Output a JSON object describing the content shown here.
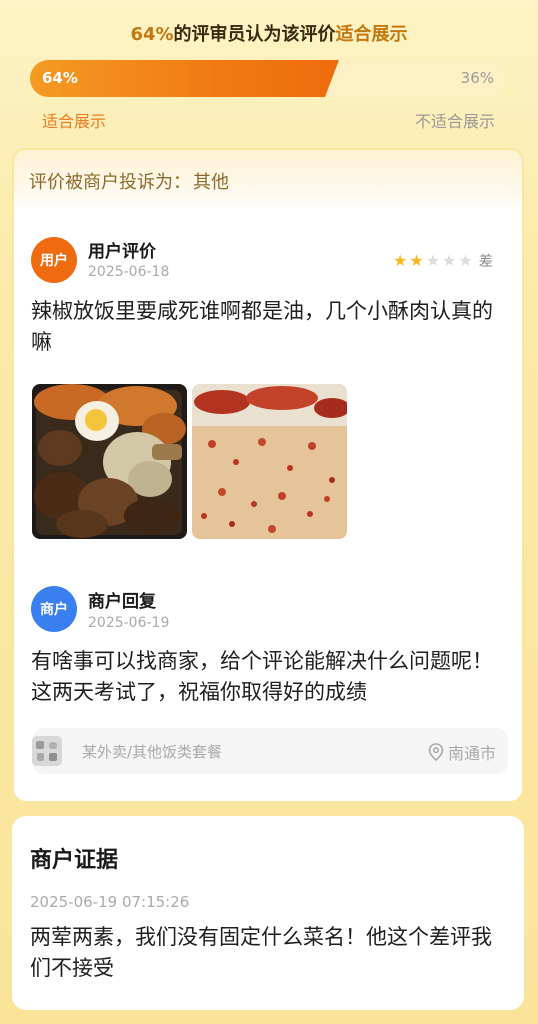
{
  "vote": {
    "pct_text": "64%",
    "title_mid": "的评审员认为该评价",
    "title_hl": "适合展示",
    "suitable_fraction": 0.64,
    "left_text": "64%",
    "right_text": "36%",
    "left_label": "适合展示",
    "right_label": "不适合展示"
  },
  "complaint": {
    "prefix": "评价被商户投诉为：",
    "value": "其他"
  },
  "user_review": {
    "avatar_label": "用户",
    "heading": "用户评价",
    "date": "2025-06-18",
    "rating": 2,
    "rating_max": 5,
    "rating_word": "差",
    "text": "辣椒放饭里要咸死谁啊都是油，几个小酥肉认真的嘛",
    "photos": [
      "photo-braised-rice-box",
      "photo-chili-fried-rice"
    ]
  },
  "merchant_reply": {
    "avatar_label": "商户",
    "heading": "商户回复",
    "date": "2025-06-19",
    "text": "有啥事可以找商家，给个评论能解决什么问题呢！这两天考试了，祝福你取得好的成绩"
  },
  "shop": {
    "name": "某外卖/其他饭类套餐",
    "city": "南通市",
    "icons": {
      "shop": "shop-icon",
      "location": "location-pin-icon"
    }
  },
  "evidence": {
    "title": "商户证据",
    "datetime": "2025-06-19 07:15:26",
    "text": "两荤两素，我们没有固定什么菜名！他这个差评我们不接受"
  },
  "colors": {
    "accent_orange": "#ef6b0f",
    "merchant_blue": "#3a7ff0",
    "star": "#f7b91f"
  }
}
